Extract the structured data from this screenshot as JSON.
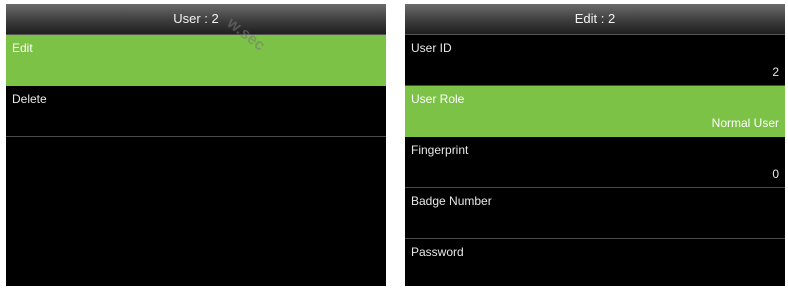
{
  "left_screen": {
    "title": "User : 2",
    "items": [
      {
        "label": "Edit",
        "selected": true
      },
      {
        "label": "Delete",
        "selected": false
      }
    ]
  },
  "right_screen": {
    "title": "Edit : 2",
    "items": [
      {
        "label": "User ID",
        "value": "2",
        "selected": false
      },
      {
        "label": "User Role",
        "value": "Normal User",
        "selected": true
      },
      {
        "label": "Fingerprint",
        "value": "0",
        "selected": false
      },
      {
        "label": "Badge Number",
        "value": "",
        "selected": false
      },
      {
        "label": "Password",
        "value": "",
        "selected": false
      }
    ]
  },
  "watermark": "w.sec",
  "colors": {
    "highlight": "#7cc247",
    "screen_bg": "#000000"
  }
}
